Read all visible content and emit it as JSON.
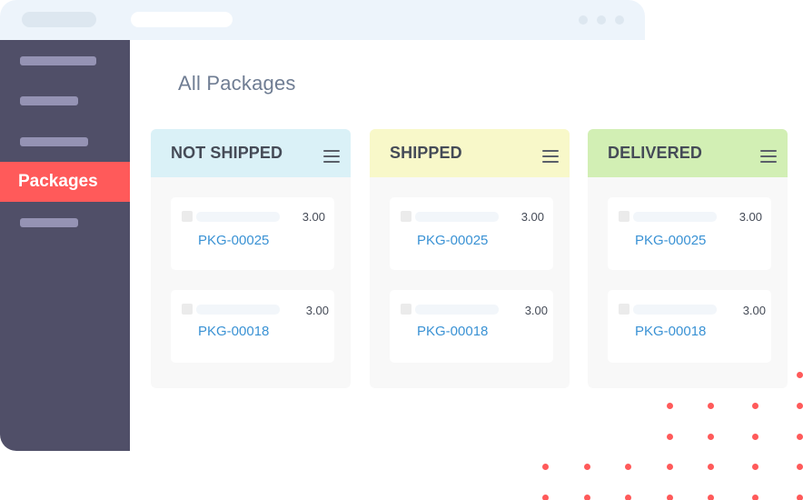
{
  "page": {
    "title": "All Packages"
  },
  "sidebar": {
    "active_item": "Packages"
  },
  "colors": {
    "accent": "#ff5a5a",
    "sidebar_bg": "#504f68",
    "link": "#3a92d4",
    "not_shipped_header": "#daf1f7",
    "shipped_header": "#f8f8c9",
    "delivered_header": "#d2efb4"
  },
  "columns": [
    {
      "title": "NOT SHIPPED",
      "cards": [
        {
          "id": "PKG-00025",
          "value": "3.00"
        },
        {
          "id": "PKG-00018",
          "value": "3.00"
        }
      ]
    },
    {
      "title": "SHIPPED",
      "cards": [
        {
          "id": "PKG-00025",
          "value": "3.00"
        },
        {
          "id": "PKG-00018",
          "value": "3.00"
        }
      ]
    },
    {
      "title": "DELIVERED",
      "cards": [
        {
          "id": "PKG-00025",
          "value": "3.00"
        },
        {
          "id": "PKG-00018",
          "value": "3.00"
        }
      ]
    }
  ]
}
